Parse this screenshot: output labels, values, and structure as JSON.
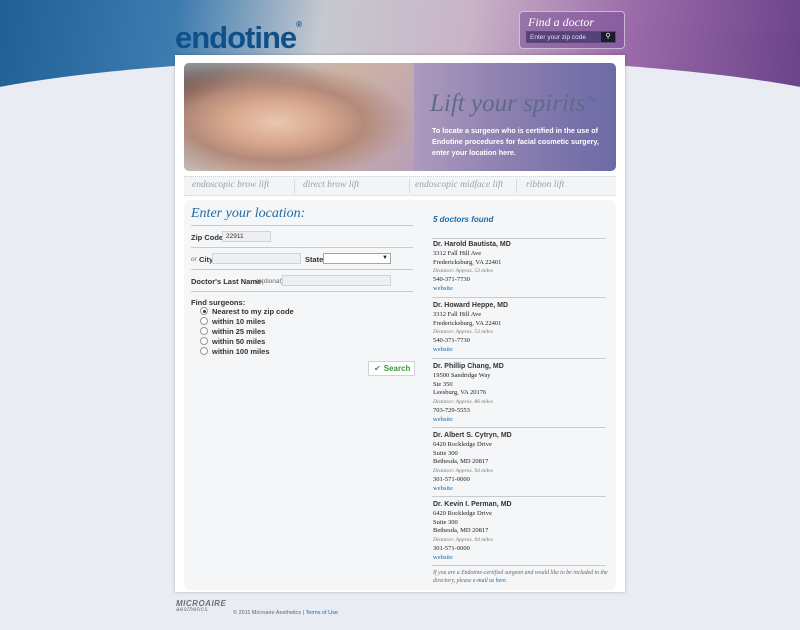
{
  "header": {
    "logo": "endotine",
    "logo_mark": "®",
    "find_doctor": {
      "title": "Find a doctor",
      "placeholder": "Enter your zip code",
      "go_icon": "search-icon"
    }
  },
  "hero": {
    "title": "Lift your spirits",
    "title_mark": "TM",
    "description": "To locate a surgeon who is certified in the use of Endotine procedures for facial cosmetic surgery, enter your location here."
  },
  "nav": {
    "items": [
      "endoscopic brow lift",
      "direct brow lift",
      "endoscopic midface lift",
      "ribbon lift"
    ]
  },
  "form": {
    "title": "Enter your location:",
    "zip_label": "Zip Code",
    "zip_value": "22911",
    "or_label": "or",
    "city_label": "City",
    "city_value": "",
    "state_label": "State",
    "state_value": "",
    "lastname_label": "Doctor's Last Name",
    "lastname_optional": "(optional)",
    "lastname_value": "",
    "find_label": "Find surgeons:",
    "radio_options": [
      {
        "label": "Nearest to my zip code",
        "selected": true
      },
      {
        "label": "within 10 miles",
        "selected": false
      },
      {
        "label": "within 25 miles",
        "selected": false
      },
      {
        "label": "within 50 miles",
        "selected": false
      },
      {
        "label": "within 100 miles",
        "selected": false
      }
    ],
    "search_label": "Search"
  },
  "results": {
    "count_label": "5 doctors found",
    "doctors": [
      {
        "name": "Dr. Harold Bautista, MD",
        "address_lines": [
          "3312 Fall Hill Ave",
          "Fredericksburg, VA 22401"
        ],
        "distance": "Distance: Approx. 53 miles",
        "phone": "540-371-7730",
        "link": "website"
      },
      {
        "name": "Dr. Howard Heppe, MD",
        "address_lines": [
          "3312 Fall Hill Ave",
          "Fredericksburg, VA 22401"
        ],
        "distance": "Distance: Approx. 53 miles",
        "phone": "540-371-7730",
        "link": "website"
      },
      {
        "name": "Dr. Phillip Chang, MD",
        "address_lines": [
          "19500 Sandridge Way",
          "Ste 350",
          "Leesburg, VA 20176"
        ],
        "distance": "Distance: Approx. 86 miles",
        "phone": "703-729-5553",
        "link": "website"
      },
      {
        "name": "Dr. Albert S. Cytryn, MD",
        "address_lines": [
          "6420 Rockledge Drive",
          "Suite 300",
          "Bethesda, MD 20817"
        ],
        "distance": "Distance: Approx. 94 miles",
        "phone": "301-571-0000",
        "link": "website"
      },
      {
        "name": "Dr. Kevin I. Perman, MD",
        "address_lines": [
          "6420 Rockledge Drive",
          "Suite 300",
          "Bethesda, MD 20817"
        ],
        "distance": "Distance: Approx. 94 miles",
        "phone": "301-571-0000",
        "link": "website"
      }
    ],
    "footnote_text": "If you are a Endotine-certified surgeon and would like to be included in the directory, please",
    "footnote_link": "e-mail us here."
  },
  "footer": {
    "brand": "MICROAIRE",
    "brand_sub": "aesthetics",
    "copyright": "© 2011 Microaire Aesthetics |",
    "terms_link": "Terms of Use"
  },
  "colors": {
    "accent": "#1e6aa6",
    "search_green": "#3a9a3a"
  }
}
